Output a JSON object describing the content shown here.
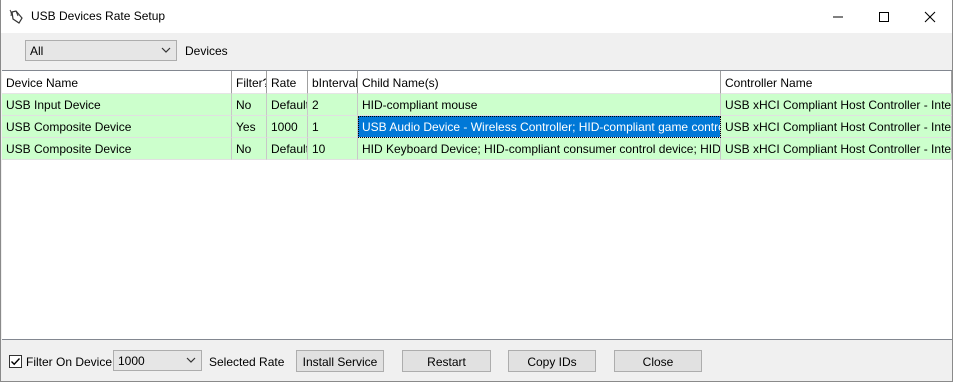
{
  "window": {
    "title": "USB Devices Rate Setup"
  },
  "filter": {
    "selected": "All",
    "label": "Devices"
  },
  "table": {
    "columns": [
      "Device Name",
      "Filter?",
      "Rate",
      "bInterval",
      "Child Name(s)",
      "Controller Name"
    ],
    "rows": [
      [
        "USB Input Device",
        "No",
        "Default",
        "2",
        "HID-compliant mouse",
        "USB xHCI Compliant Host Controller - Intel(R) USB"
      ],
      [
        "USB Composite Device",
        "Yes",
        "1000",
        "1",
        "USB Audio Device - Wireless Controller; HID-compliant game controller",
        "USB xHCI Compliant Host Controller - Intel(R) USB"
      ],
      [
        "USB Composite Device",
        "No",
        "Default",
        "10",
        "HID Keyboard Device; HID-compliant consumer control device; HID-compliant",
        "USB xHCI Compliant Host Controller - Intel(R) USB"
      ]
    ],
    "row_color": "#ccffcc",
    "selection_color": "#0078d7"
  },
  "bottom": {
    "filter_on_device_label": "Filter On Device",
    "filter_on_device_checked": true,
    "rate_value": "1000",
    "selected_rate_label": "Selected Rate",
    "install_label": "Install Service",
    "restart_label": "Restart",
    "copy_label": "Copy IDs",
    "close_label": "Close"
  }
}
